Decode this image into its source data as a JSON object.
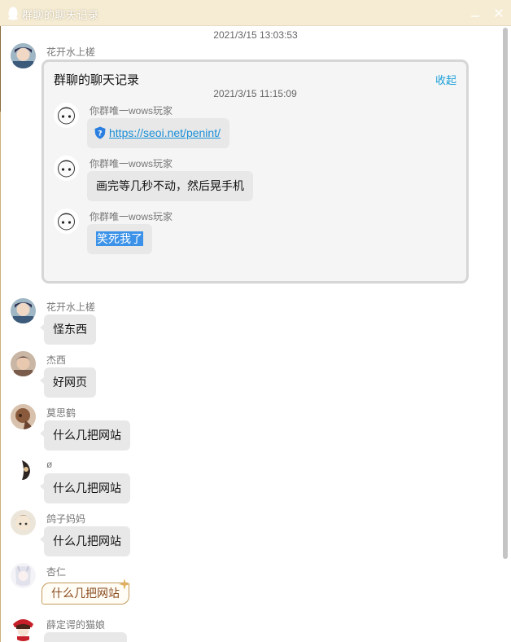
{
  "window": {
    "title": "群聊的聊天记录",
    "app_icon": "qq-penguin-icon",
    "controls": [
      "minimize-icon",
      "close-icon"
    ]
  },
  "colors": {
    "titlebar": "#f5ecd3",
    "bubble": "#e8e8e8",
    "link": "#1a8fd8",
    "collapse": "#1a9fd8",
    "selection": "#3b92e8"
  },
  "chat": {
    "timestamp": "2021/3/15 13:03:53",
    "forward_message": {
      "sender": "花开水上槎",
      "card_title": "群聊的聊天记录",
      "collapse_label": "收起",
      "time": "2021/3/15 11:15:09",
      "messages": [
        {
          "sender": "你群唯一wows玩家",
          "icon": "shield-question-icon",
          "text": "https://seoi.net/penint/"
        },
        {
          "sender": "你群唯一wows玩家",
          "text": "画完等几秒不动，然后晃手机"
        },
        {
          "sender": "你群唯一wows玩家",
          "text": "笑死我了",
          "selected": true
        }
      ]
    },
    "messages": [
      {
        "sender": "花开水上槎",
        "text": "怪东西"
      },
      {
        "sender": "杰西",
        "text": "好网页"
      },
      {
        "sender": "莫思鹤",
        "text": "什么几把网站"
      },
      {
        "sender": "ø",
        "text": "什么几把网站"
      },
      {
        "sender": "鸽子妈妈",
        "text": "什么几把网站"
      },
      {
        "sender": "杏仁",
        "text": "什么几把网站",
        "bubble_style": "decorated"
      },
      {
        "sender": "薛定谔的猫娘",
        "text": ""
      }
    ]
  },
  "scrollbar": {
    "position": 0.0
  }
}
